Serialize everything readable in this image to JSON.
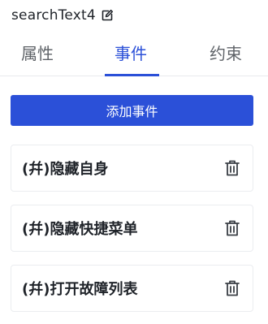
{
  "component": {
    "name": "searchText4"
  },
  "tabs": [
    {
      "label": "属性",
      "active": false
    },
    {
      "label": "事件",
      "active": true
    },
    {
      "label": "约束",
      "active": false
    }
  ],
  "add_event_button": {
    "label": "添加事件"
  },
  "events": [
    {
      "label": "(幷)隐藏自身",
      "icon": "trash-icon"
    },
    {
      "label": "(幷)隐藏快捷菜单",
      "icon": "trash-icon"
    },
    {
      "label": "(幷)打开故障列表",
      "icon": "trash-icon"
    }
  ],
  "colors": {
    "accent": "#2b50d8",
    "text": "#1f2329",
    "muted": "#5f6368"
  }
}
